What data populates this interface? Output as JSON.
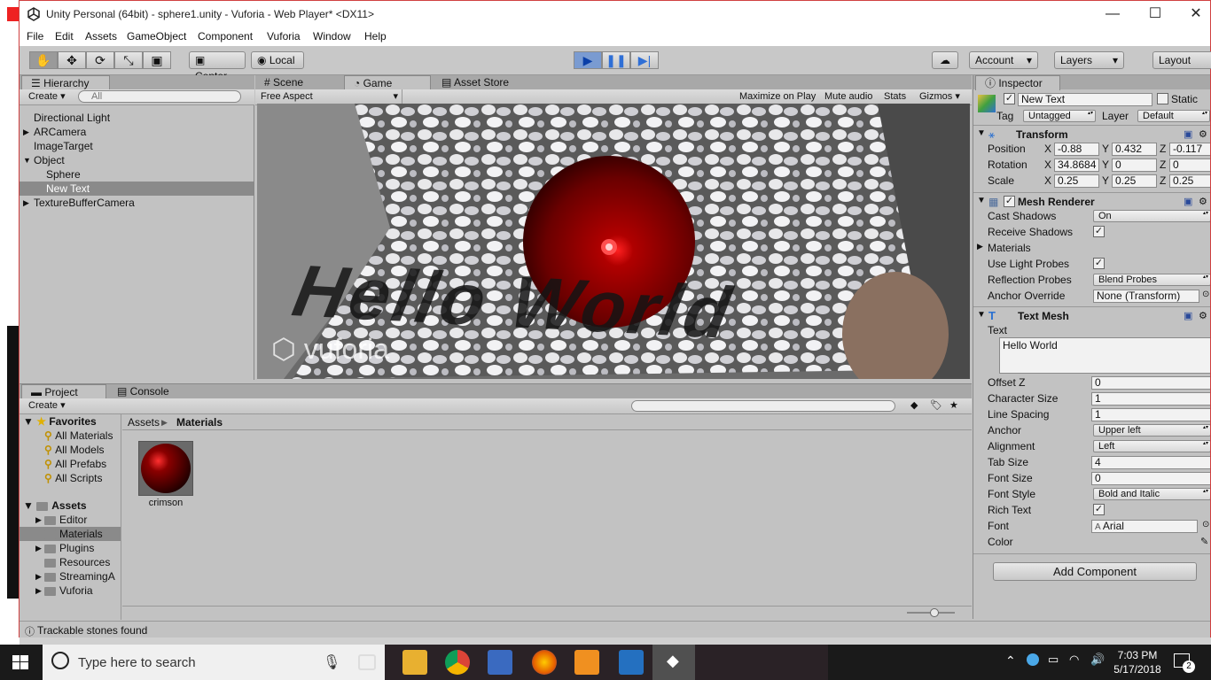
{
  "window": {
    "title": "Unity Personal (64bit) - sphere1.unity - Vuforia - Web Player* <DX11>",
    "controls": [
      "—",
      "☐",
      "✕"
    ]
  },
  "menu": [
    "File",
    "Edit",
    "Assets",
    "GameObject",
    "Component",
    "Vuforia",
    "Window",
    "Help"
  ],
  "toolbar": {
    "center_label": "Center",
    "local_label": "Local",
    "account_label": "Account",
    "layers_label": "Layers",
    "layout_label": "Layout"
  },
  "hierarchy": {
    "tab": "Hierarchy",
    "create": "Create",
    "search_placeholder": "All",
    "items": [
      {
        "label": "Directional Light",
        "indent": 0,
        "arrow": ""
      },
      {
        "label": "ARCamera",
        "indent": 0,
        "arrow": "▶"
      },
      {
        "label": "ImageTarget",
        "indent": 0,
        "arrow": ""
      },
      {
        "label": "Object",
        "indent": 0,
        "arrow": "▼"
      },
      {
        "label": "Sphere",
        "indent": 1,
        "arrow": ""
      },
      {
        "label": "New Text",
        "indent": 1,
        "arrow": "",
        "selected": true
      },
      {
        "label": "TextureBufferCamera",
        "indent": 0,
        "arrow": "▶"
      }
    ]
  },
  "scene_tabs": {
    "scene": "Scene",
    "game": "Game",
    "asset_store": "Asset Store"
  },
  "game_bar": {
    "aspect": "Free Aspect",
    "maximize": "Maximize on Play",
    "mute": "Mute audio",
    "stats": "Stats",
    "gizmos": "Gizmos"
  },
  "game_view": {
    "overlay_text": "Hello World",
    "watermark": "vuforia"
  },
  "project": {
    "tab_project": "Project",
    "tab_console": "Console",
    "create": "Create",
    "breadcrumb_root": "Assets",
    "breadcrumb_current": "Materials",
    "favorites_label": "Favorites",
    "favorites": [
      "All Materials",
      "All Models",
      "All Prefabs",
      "All Scripts"
    ],
    "assets_label": "Assets",
    "folders": [
      {
        "label": "Editor",
        "arrow": "▶"
      },
      {
        "label": "Materials",
        "arrow": "",
        "selected": true
      },
      {
        "label": "Plugins",
        "arrow": "▶"
      },
      {
        "label": "Resources",
        "arrow": ""
      },
      {
        "label": "StreamingA",
        "arrow": "▶"
      },
      {
        "label": "Vuforia",
        "arrow": "▶"
      }
    ],
    "asset_name": "crimson"
  },
  "status": {
    "message": "Trackable stones found"
  },
  "inspector": {
    "tab": "Inspector",
    "object_name": "New Text",
    "static_label": "Static",
    "tag_label": "Tag",
    "tag_value": "Untagged",
    "layer_label": "Layer",
    "layer_value": "Default",
    "transform": {
      "title": "Transform",
      "position_label": "Position",
      "rotation_label": "Rotation",
      "scale_label": "Scale",
      "position": [
        "-0.88",
        "0.432",
        "-0.117"
      ],
      "rotation": [
        "34.8684",
        "0",
        "0"
      ],
      "scale": [
        "0.25",
        "0.25",
        "0.25"
      ]
    },
    "mesh_renderer": {
      "title": "Mesh Renderer",
      "cast_shadows_label": "Cast Shadows",
      "cast_shadows_value": "On",
      "receive_shadows_label": "Receive Shadows",
      "materials_label": "Materials",
      "light_probes_label": "Use Light Probes",
      "reflection_label": "Reflection Probes",
      "reflection_value": "Blend Probes",
      "anchor_override_label": "Anchor Override",
      "anchor_override_value": "None (Transform)"
    },
    "text_mesh": {
      "title": "Text Mesh",
      "text_label": "Text",
      "text_value": "Hello World",
      "offset_z_label": "Offset Z",
      "offset_z": "0",
      "char_size_label": "Character Size",
      "char_size": "1",
      "line_spacing_label": "Line Spacing",
      "line_spacing": "1",
      "anchor_label": "Anchor",
      "anchor": "Upper left",
      "alignment_label": "Alignment",
      "alignment": "Left",
      "tab_size_label": "Tab Size",
      "tab_size": "4",
      "font_size_label": "Font Size",
      "font_size": "0",
      "font_style_label": "Font Style",
      "font_style": "Bold and Italic",
      "rich_text_label": "Rich Text",
      "font_label": "Font",
      "font": "Arial",
      "color_label": "Color"
    },
    "add_component": "Add Component"
  },
  "taskbar": {
    "search_placeholder": "Type here to search",
    "time": "7:03 PM",
    "date": "5/17/2018",
    "notification_count": "2"
  },
  "colors": {
    "play_blue": "#2f6fd6",
    "text_mesh_color": "#000000",
    "sphere_red": "#c00000"
  }
}
